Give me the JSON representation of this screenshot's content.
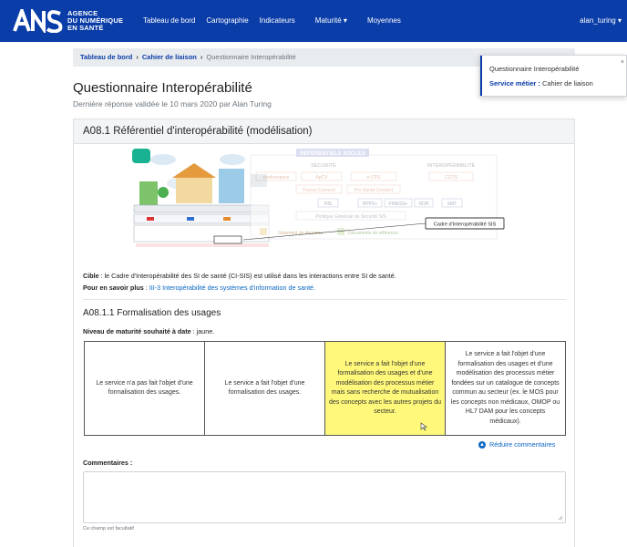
{
  "brand": {
    "logo_letters": "ANS",
    "line1": "AGENCE",
    "line2": "DU NUMÉRIQUE",
    "line3": "EN SANTÉ"
  },
  "nav": {
    "items": [
      "Tableau de bord",
      "Cartographie",
      "Indicateurs",
      "Maturité",
      "Moyennes"
    ],
    "maturite_caret": "▾",
    "user": "alan_turing ▾"
  },
  "breadcrumb": {
    "item1": "Tableau de bord",
    "item2": "Cahier de liaison",
    "current": "Questionnaire Interopérabilité"
  },
  "floatpanel": {
    "title": "Questionnaire Interopérabilité",
    "label": "Service métier :",
    "value": "Cahier de liaison"
  },
  "page": {
    "title": "Questionnaire Interopérabilité",
    "subtitle": "Dernière réponse validée le 10 mars 2020 par Alan Turing"
  },
  "card": {
    "title": "A08.1 Référentiel d'interopérabilité (modélisation)",
    "diagram": {
      "header": "RÉFÉRENTIELS SOCLES",
      "securite": "SÉCURITÉ",
      "interop": "INTEROPÉRABILITÉ",
      "row1": [
        "conformance",
        "ApCV",
        "e-CPS",
        "CGTS"
      ],
      "row2": [
        "France Connect",
        "Pro Santé Connect"
      ],
      "row3": [
        "INS",
        "RPPS+",
        "FINESS+",
        "ROR",
        "SMT"
      ],
      "row4": "Politique Générale de Sécurité SIS",
      "callout": "Cadre d'Interopérabilité SIS",
      "legend1": "Gisement de données",
      "legend2": "Documents de référence"
    },
    "cible_label": "Cible",
    "cible_text": " : le Cadre d'Interopérabilité des SI de santé (CI-SIS) est utilisé dans les interactions entre SI de santé.",
    "savoir_label": "Pour en savoir plus",
    "savoir_sep": " : ",
    "savoir_link": "III-3 Interopérabilité des systèmes d'information de santé.",
    "section_title": "A08.1.1 Formalisation des usages",
    "niveau_label": "Niveau de maturité souhaité à date",
    "niveau_value": " : jaune.",
    "levels": [
      "Le service n'a pas fait l'objet d'une formalisation des usages.",
      "Le service a fait l'objet d'une formalisation des usages.",
      "Le service a fait l'objet d'une formalisation des usages et d'une modélisation des processus métier mais sans recherche de mutualisation des concepts avec les autres projets du secteur.",
      "Le service a fait l'objet d'une formalisation des usages et d'une modélisation des processus métier fondées sur un catalogue de concepts commun au secteur (ex. le MOS pour les concepts non médicaux, OMOP ou HL7 DAM pour les concepts médicaux)."
    ],
    "selected_level": 3,
    "reduire": "Réduire commentaires",
    "comments_label": "Commentaires :",
    "comments_value": "",
    "hint": "Ce champ est facultatif"
  },
  "colors": {
    "nav_bg": "#0a3da8",
    "selected_level": "#fff87a",
    "link": "#0a66c2"
  }
}
